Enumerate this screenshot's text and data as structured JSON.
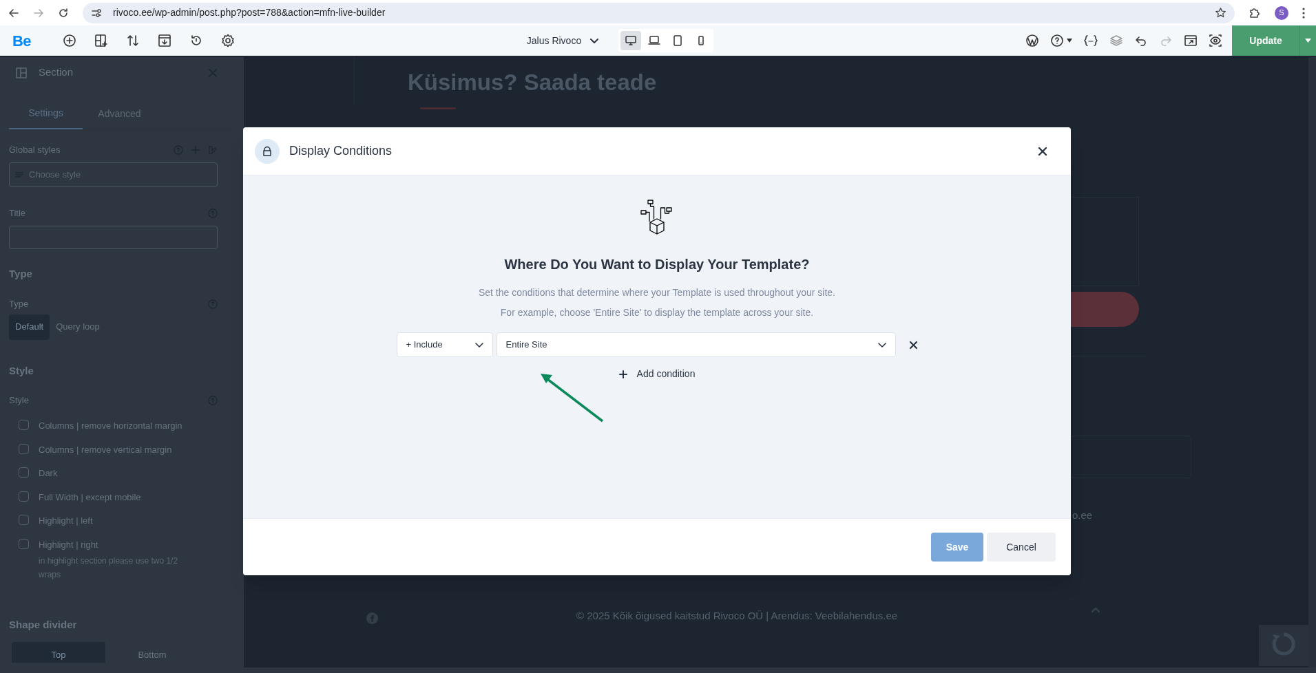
{
  "browser": {
    "url": "rivoco.ee/wp-admin/post.php?post=788&action=mfn-live-builder",
    "profile_initial": "S"
  },
  "toolbar": {
    "logo": "Be",
    "template_name": "Jalus Rivoco",
    "devices": [
      {
        "kind": "desktop",
        "selected": true
      },
      {
        "kind": "laptop",
        "selected": false
      },
      {
        "kind": "tablet",
        "selected": false
      },
      {
        "kind": "mobile",
        "selected": false
      }
    ],
    "update_button": "Update"
  },
  "sidebar": {
    "title": "Section",
    "tabs": [
      {
        "label": "Settings",
        "selected": true
      },
      {
        "label": "Advanced",
        "selected": false
      }
    ],
    "global_styles": {
      "label": "Global styles",
      "placeholder": "Choose style"
    },
    "title_field": {
      "label": "Title"
    },
    "type_section": {
      "heading": "Type",
      "label": "Type",
      "options": [
        {
          "label": "Default",
          "selected": true
        },
        {
          "label": "Query loop",
          "selected": false
        }
      ]
    },
    "style_section": {
      "heading": "Style",
      "label": "Style",
      "options": [
        {
          "label": "Columns | remove horizontal margin",
          "checked": false
        },
        {
          "label": "Columns | remove vertical margin",
          "checked": false
        },
        {
          "label": "Dark",
          "checked": false
        },
        {
          "label": "Full Width | except mobile",
          "checked": false
        },
        {
          "label": "Highlight | left",
          "checked": false
        },
        {
          "label": "Highlight | right",
          "checked": false,
          "hint": "in highlight section please use two 1/2 wraps"
        }
      ]
    },
    "shape_divider": {
      "heading": "Shape divider",
      "options": [
        {
          "label": "Top",
          "selected": true
        },
        {
          "label": "Bottom",
          "selected": false
        }
      ]
    }
  },
  "canvas": {
    "heading": "Küsimus? Saada teade",
    "partial_text": "o.ee",
    "footer": "© 2025 Kõik õigused kaitstud Rivoco OÜ | Arendus: Veebilahendus.ee"
  },
  "modal": {
    "title": "Display Conditions",
    "heading": "Where Do You Want to Display Your Template?",
    "description": [
      "Set the conditions that determine where your Template is used throughout your site.",
      "For example, choose 'Entire Site' to display the template across your site."
    ],
    "conditions": [
      {
        "mode": "+ Include",
        "target": "Entire Site"
      }
    ],
    "add_button": "Add condition",
    "save_button": {
      "label": "Save",
      "disabled": true
    },
    "cancel_button": "Cancel"
  }
}
